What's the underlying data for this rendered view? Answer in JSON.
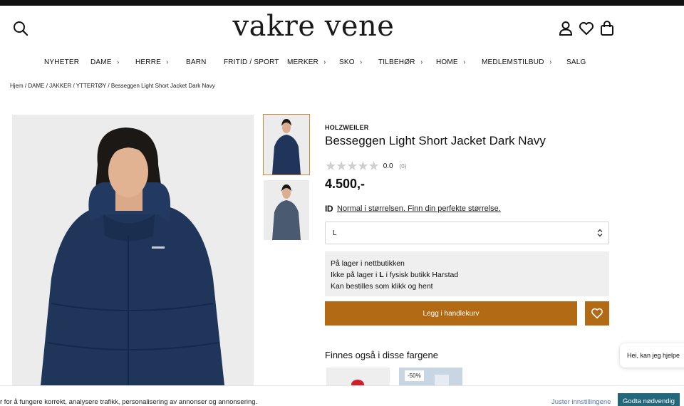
{
  "header": {
    "logo": "vakre vene",
    "icons": [
      "search-icon",
      "account-icon",
      "heart-icon",
      "bag-icon"
    ]
  },
  "nav": {
    "items": [
      {
        "label": "NYHETER",
        "has_submenu": false
      },
      {
        "label": "DAME",
        "has_submenu": true
      },
      {
        "label": "HERRE",
        "has_submenu": true
      },
      {
        "label": "BARN",
        "has_submenu": false
      },
      {
        "label": "FRITID / SPORT",
        "has_submenu": false
      },
      {
        "label": "MERKER",
        "has_submenu": true
      },
      {
        "label": "SKO",
        "has_submenu": true
      },
      {
        "label": "TILBEHØR",
        "has_submenu": true
      },
      {
        "label": "HOME",
        "has_submenu": true
      },
      {
        "label": "MEDLEMSTILBUD",
        "has_submenu": true
      },
      {
        "label": "SALG",
        "has_submenu": false
      }
    ],
    "chevron": "›"
  },
  "breadcrumb": {
    "items": [
      "Hjem",
      "DAME",
      "JAKKER",
      "YTTERTØY",
      "Besseggen Light Short Jacket Dark Navy"
    ],
    "separator": " / "
  },
  "product": {
    "brand": "HOLZWEILER",
    "title": "Besseggen Light Short Jacket Dark Navy",
    "stars": "★★★★★",
    "rating": "0.0",
    "review_count": "(0)",
    "price": "4.500,-",
    "fit_logo": "ID",
    "fit_text": "Normal i størrelsen. Finn din perfekte størrelse.",
    "selected_size": "L",
    "stock": {
      "line1": "På lager i nettbutikken",
      "line2_pre": "Ikke på lager i ",
      "line2_size": "L",
      "line2_post": " i fysisk butikk Harstad",
      "line3": "Kan bestilles som klikk og hent"
    },
    "add_to_cart": "Legg i handlekurv",
    "colors_heading": "Finnes også i disse fargene",
    "sale_badge": "-50%",
    "colors": {
      "jacket": "#1c3258",
      "jacket_alt": "#4a5a70",
      "accent": "#b36a14"
    }
  },
  "chat": {
    "text": "Hei, kan jeg hjelpe"
  },
  "cookie": {
    "text": "r for å fungere korrekt, analysere trafikk, personalisering av annonser og annonsering.",
    "settings": "Juster innstillingene",
    "accept": "Godta nødvendig"
  }
}
